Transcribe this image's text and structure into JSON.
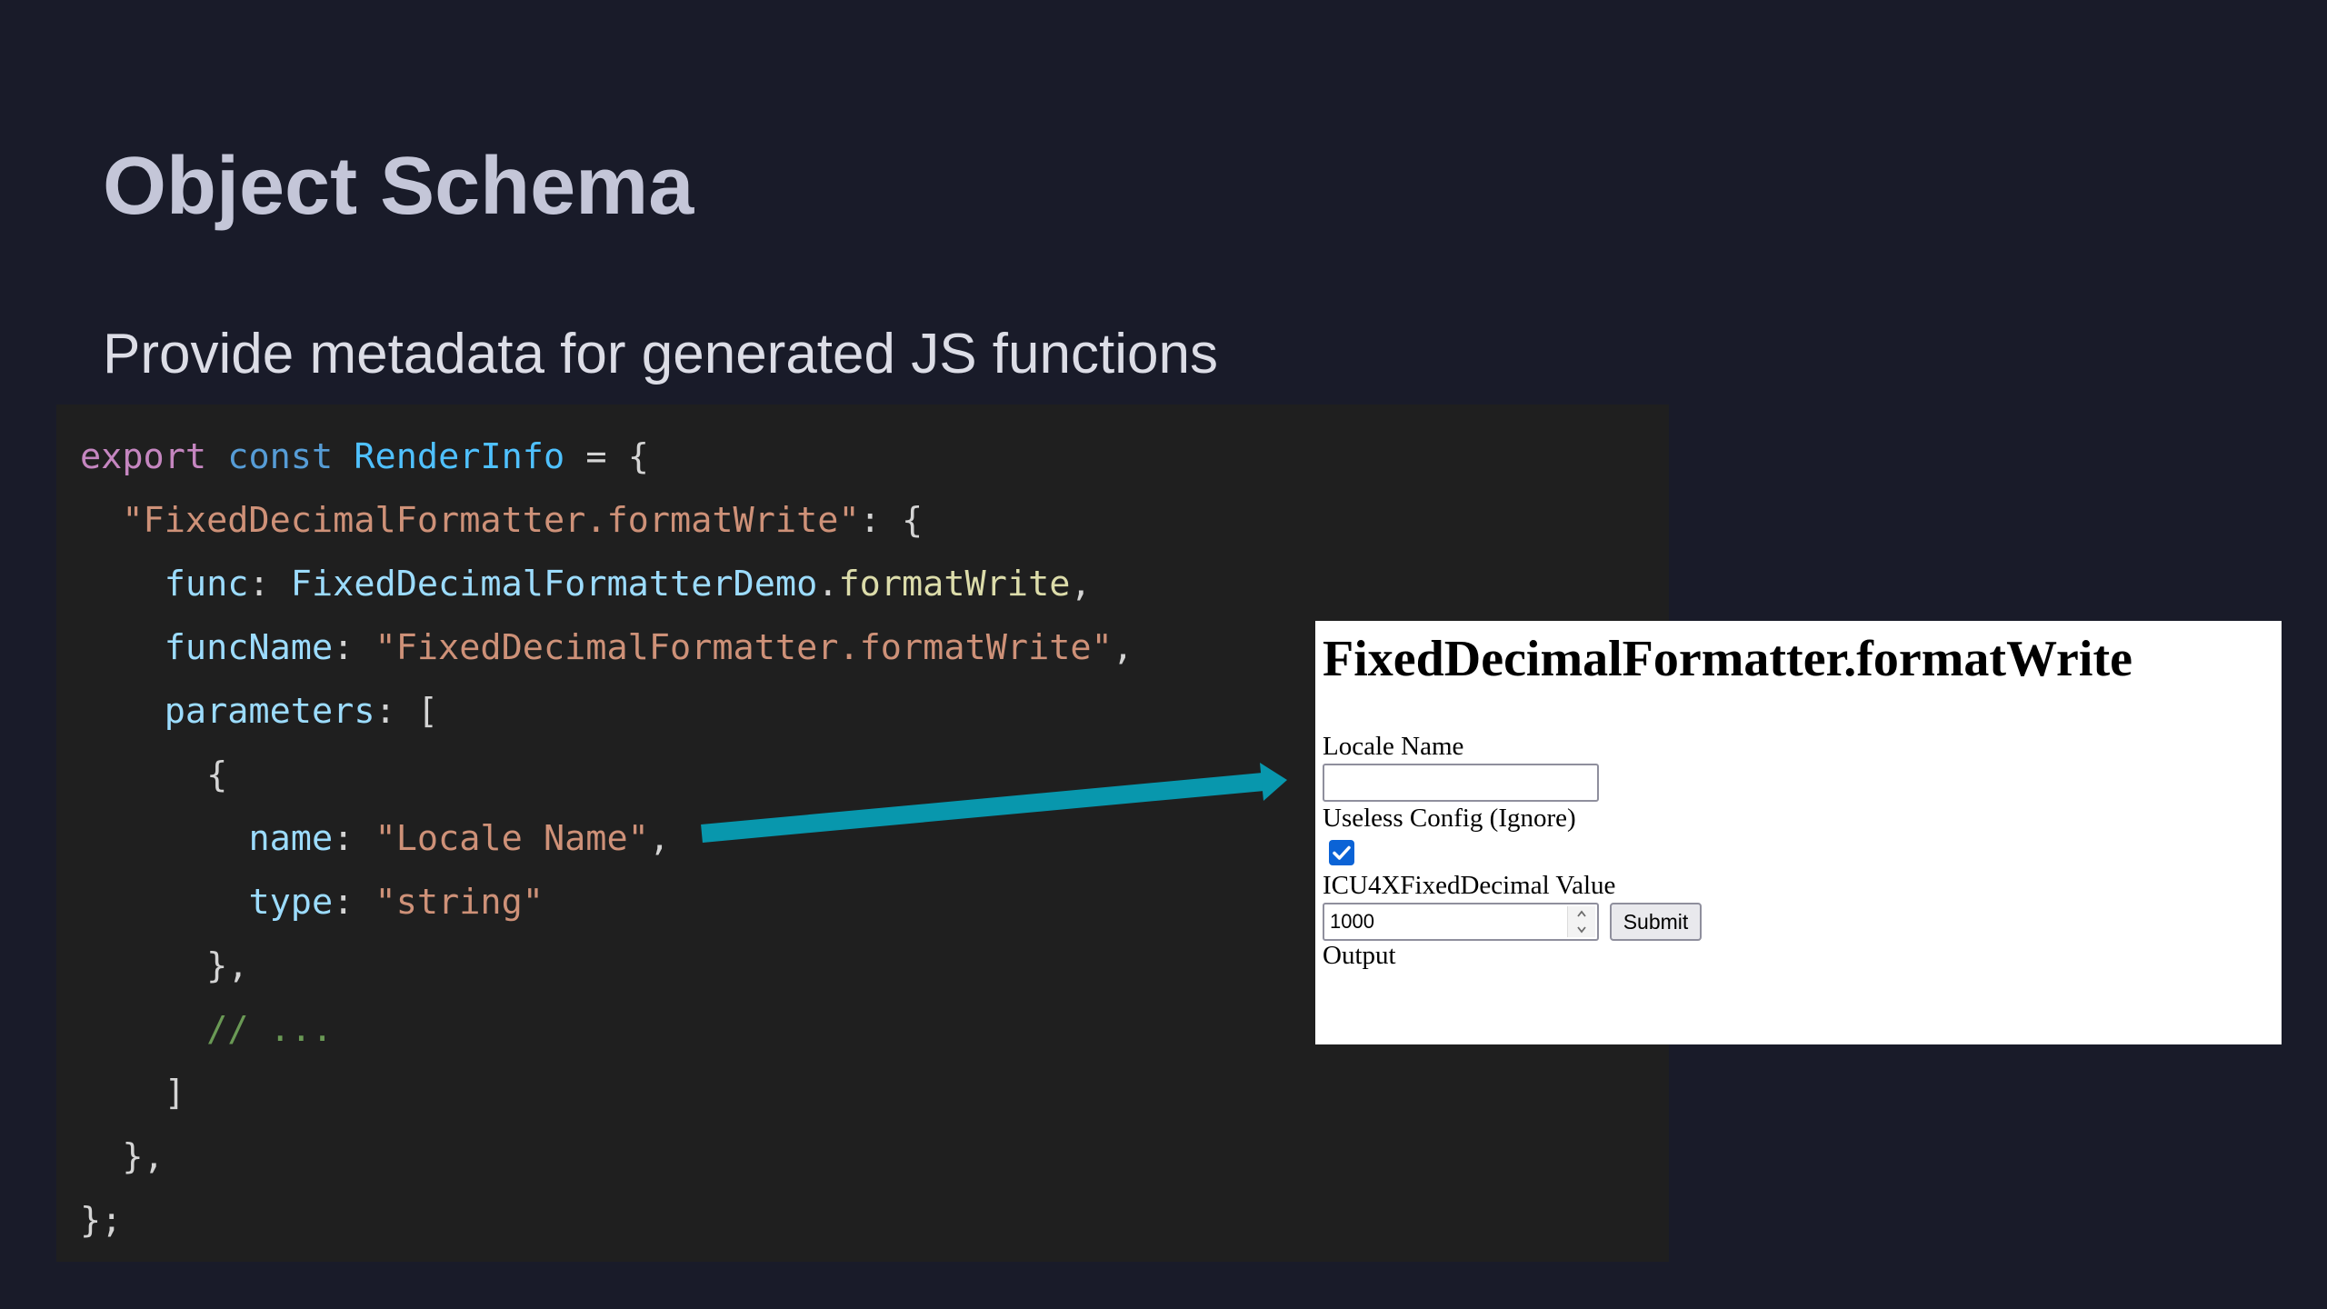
{
  "slide": {
    "title": "Object Schema",
    "subtitle": "Provide metadata for generated JS functions"
  },
  "code": {
    "lines": [
      [
        {
          "t": "export",
          "k": "key"
        },
        {
          "t": " "
        },
        {
          "t": "const",
          "k": "kw"
        },
        {
          "t": " "
        },
        {
          "t": "RenderInfo",
          "k": "const"
        },
        {
          "t": " = {"
        }
      ],
      [
        {
          "t": "  "
        },
        {
          "t": "\"FixedDecimalFormatter.formatWrite\"",
          "k": "str"
        },
        {
          "t": ": {"
        }
      ],
      [
        {
          "t": "    "
        },
        {
          "t": "func",
          "k": "prop"
        },
        {
          "t": ": "
        },
        {
          "t": "FixedDecimalFormatterDemo",
          "k": "prop"
        },
        {
          "t": "."
        },
        {
          "t": "formatWrite",
          "k": "fn"
        },
        {
          "t": ","
        }
      ],
      [
        {
          "t": "    "
        },
        {
          "t": "funcName",
          "k": "prop"
        },
        {
          "t": ": "
        },
        {
          "t": "\"FixedDecimalFormatter.formatWrite\"",
          "k": "str"
        },
        {
          "t": ","
        }
      ],
      [
        {
          "t": "    "
        },
        {
          "t": "parameters",
          "k": "prop"
        },
        {
          "t": ": ["
        }
      ],
      [
        {
          "t": "      {"
        }
      ],
      [
        {
          "t": "        "
        },
        {
          "t": "name",
          "k": "prop"
        },
        {
          "t": ": "
        },
        {
          "t": "\"Locale Name\"",
          "k": "str"
        },
        {
          "t": ","
        }
      ],
      [
        {
          "t": "        "
        },
        {
          "t": "type",
          "k": "prop"
        },
        {
          "t": ": "
        },
        {
          "t": "\"string\"",
          "k": "str"
        }
      ],
      [
        {
          "t": "      },"
        }
      ],
      [
        {
          "t": "      "
        },
        {
          "t": "// ...",
          "k": "comment"
        }
      ],
      [
        {
          "t": "    ]"
        }
      ],
      [
        {
          "t": "  },"
        }
      ],
      [
        {
          "t": "};"
        }
      ]
    ]
  },
  "arrow": {
    "color": "#0897ad",
    "icon": "arrow-right-icon"
  },
  "demo": {
    "heading": "FixedDecimalFormatter.formatWrite",
    "locale_label": "Locale Name",
    "locale_value": "",
    "config_label": "Useless Config (Ignore)",
    "config_checked": true,
    "value_label": "ICU4XFixedDecimal Value",
    "value": "1000",
    "submit_label": "Submit",
    "output_label": "Output"
  },
  "colors": {
    "background": "#191b29",
    "code_panel": "#1f1f1f",
    "title": "#c4c6d8",
    "checkbox_accent": "#0b63d6"
  }
}
